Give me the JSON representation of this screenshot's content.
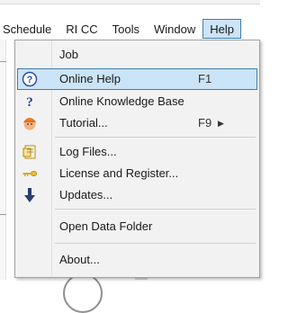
{
  "menubar": {
    "items": [
      "Schedule",
      "RI CC",
      "Tools",
      "Window",
      "Help"
    ],
    "active": "Help"
  },
  "help_menu": {
    "items": [
      {
        "label": "Job",
        "shortcut": "",
        "icon": "none"
      },
      {
        "label": "Online Help",
        "shortcut": "F1",
        "icon": "help-circle-icon",
        "highlighted": true
      },
      {
        "label": "Online Knowledge Base",
        "shortcut": "",
        "icon": "question-mark-icon"
      },
      {
        "label": "Tutorial...",
        "shortcut": "F9",
        "icon": "tutorial-avatar-icon",
        "submenu": true
      },
      {
        "label": "Log Files...",
        "shortcut": "",
        "icon": "log-file-icon"
      },
      {
        "label": "License and Register...",
        "shortcut": "",
        "icon": "key-icon"
      },
      {
        "label": "Updates...",
        "shortcut": "",
        "icon": "download-arrow-icon"
      },
      {
        "label": "Open Data Folder",
        "shortcut": "",
        "icon": "none"
      },
      {
        "label": "About...",
        "shortcut": "",
        "icon": "none"
      }
    ]
  },
  "colors": {
    "highlight_bg": "#cce4f7",
    "highlight_border": "#3c7fb1",
    "menu_bg": "#f2f2f2"
  }
}
